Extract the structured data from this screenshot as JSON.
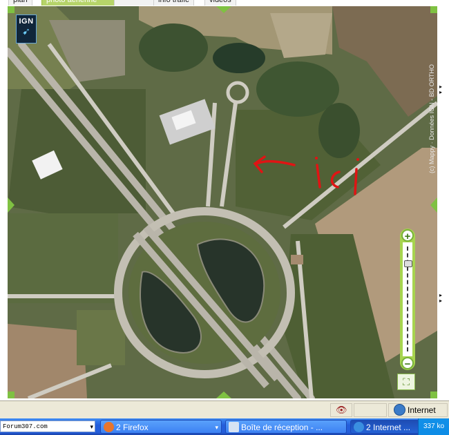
{
  "tabs": [
    {
      "label": "plan",
      "active": false
    },
    {
      "label": "photo aérienne",
      "active": true
    },
    {
      "label": "",
      "active": false
    },
    {
      "label": "info trafic",
      "active": false
    },
    {
      "label": "vidéos",
      "active": false
    }
  ],
  "map": {
    "logo_text": "IGN",
    "copyright": "(c) Mappy · Données IGN - BD ORTHO",
    "annotation": "ici",
    "zoom": {
      "plus": "+",
      "minus": "−",
      "level": 0.72
    }
  },
  "statusbar": {
    "zone_label": "Internet"
  },
  "taskbar": {
    "address": "Forum307.com",
    "buttons": [
      {
        "label": "2 Firefox",
        "icon": "firefox-icon"
      },
      {
        "label": "Boîte de réception - ...",
        "icon": "mail-icon"
      },
      {
        "label": "2 Internet ...",
        "icon": "ie-icon"
      }
    ],
    "tray": "337 ko"
  },
  "colors": {
    "accent": "#7fc142",
    "annotation": "#e01414",
    "taskbar": "#245edb"
  }
}
